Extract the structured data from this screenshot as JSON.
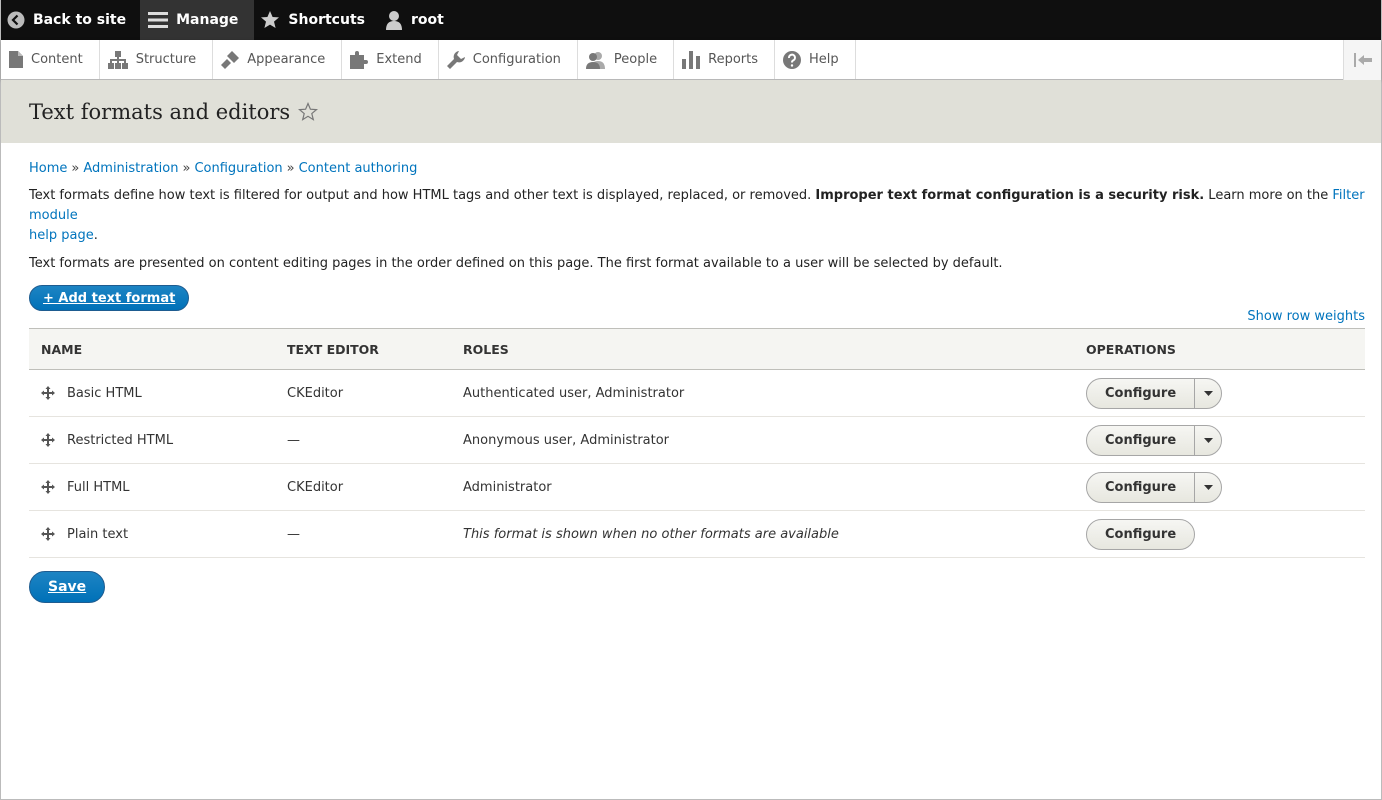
{
  "toolbar": {
    "back": "Back to site",
    "manage": "Manage",
    "shortcuts": "Shortcuts",
    "user": "root"
  },
  "tray": {
    "items": [
      "Content",
      "Structure",
      "Appearance",
      "Extend",
      "Configuration",
      "People",
      "Reports",
      "Help"
    ]
  },
  "page": {
    "title": "Text formats and editors"
  },
  "breadcrumb": [
    "Home",
    "Administration",
    "Configuration",
    "Content authoring"
  ],
  "breadcrumb_sep": "»",
  "description": {
    "part1": "Text formats define how text is filtered for output and how HTML tags and other text is displayed, replaced, or removed. ",
    "bold": "Improper text format configuration is a security risk.",
    "part2": " Learn more on the ",
    "link1": "Filter module",
    "link2": "help page",
    "end": ".",
    "second": "Text formats are presented on content editing pages in the order defined on this page. The first format available to a user will be selected by default."
  },
  "add_button": "+ Add text format",
  "row_weights": "Show row weights",
  "table": {
    "headers": [
      "Name",
      "Text editor",
      "Roles",
      "Operations"
    ],
    "rows": [
      {
        "name": "Basic HTML",
        "editor": "CKEditor",
        "roles": "Authenticated user, Administrator",
        "op": "Configure"
      },
      {
        "name": "Restricted HTML",
        "editor": "—",
        "roles": "Anonymous user, Administrator",
        "op": "Configure"
      },
      {
        "name": "Full HTML",
        "editor": "CKEditor",
        "roles": "Administrator",
        "op": "Configure"
      },
      {
        "name": "Plain text",
        "editor": "—",
        "roles": "This format is shown when no other formats are available",
        "op": "Configure"
      }
    ]
  },
  "save": "Save",
  "colors": {
    "link": "#0074bd",
    "primary": "#0071b8",
    "toolbar_bg": "#0f0f0f",
    "header_bg": "#e0e0d8"
  }
}
